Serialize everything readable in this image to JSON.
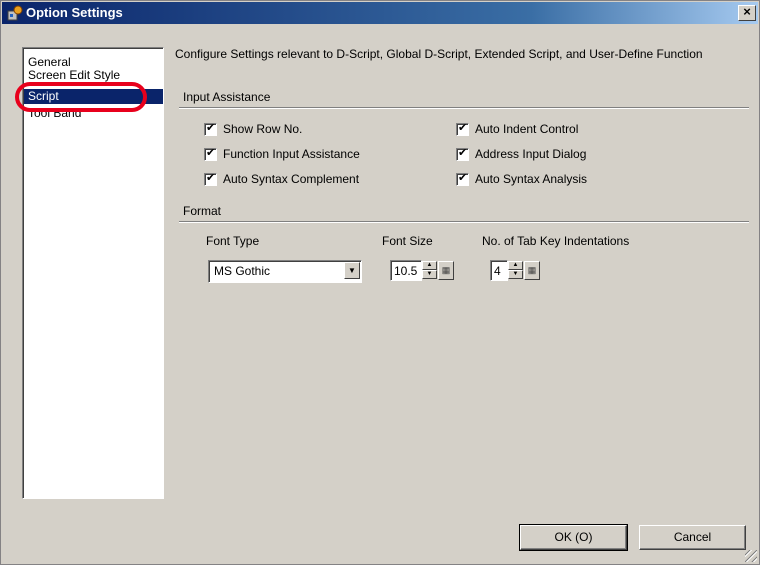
{
  "window": {
    "title": "Option Settings",
    "close_label": "×"
  },
  "sidebar": {
    "items": [
      {
        "label": "General"
      },
      {
        "label": "Screen Edit Style"
      },
      {
        "label": "Script"
      },
      {
        "label": "Tool Band"
      }
    ],
    "selected": "Script"
  },
  "main": {
    "description": "Configure Settings relevant to D-Script, Global D-Script, Extended Script, and User-Define Function",
    "input_assistance": {
      "title": "Input Assistance",
      "options": [
        {
          "label": "Show Row No.",
          "checked": true
        },
        {
          "label": "Function Input Assistance",
          "checked": true
        },
        {
          "label": "Auto Syntax Complement",
          "checked": true
        },
        {
          "label": "Auto Indent Control",
          "checked": true
        },
        {
          "label": "Address Input Dialog",
          "checked": true
        },
        {
          "label": "Auto Syntax Analysis",
          "checked": true
        }
      ]
    },
    "format": {
      "title": "Format",
      "font_type_label": "Font Type",
      "font_type_value": "MS Gothic",
      "font_size_label": "Font Size",
      "font_size_value": "10.5",
      "tab_indent_label": "No. of Tab Key Indentations",
      "tab_indent_value": "4"
    }
  },
  "footer": {
    "ok_label": "OK (O)",
    "cancel_label": "Cancel"
  },
  "colors": {
    "highlight_circle": "#e8001c",
    "selection": "#0a246a",
    "face": "#d4d0c8"
  }
}
